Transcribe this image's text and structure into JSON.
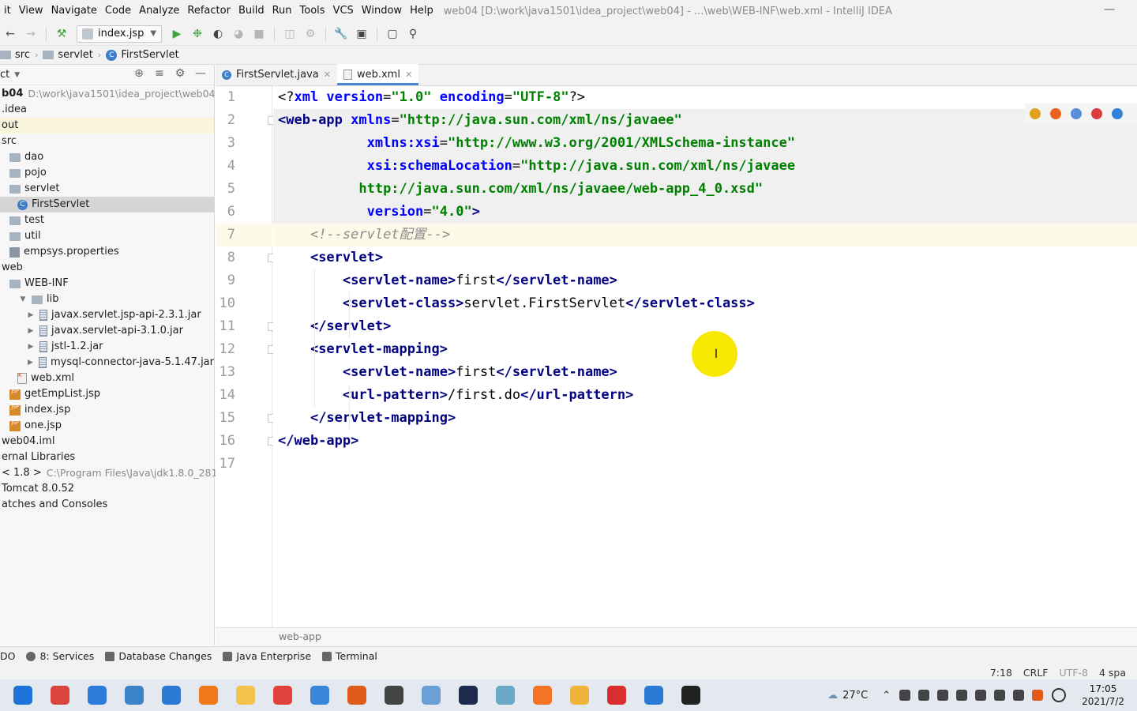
{
  "menubar": {
    "items": [
      "it",
      "View",
      "Navigate",
      "Code",
      "Analyze",
      "Refactor",
      "Build",
      "Run",
      "Tools",
      "VCS",
      "Window",
      "Help"
    ],
    "title": "web04 [D:\\work\\java1501\\idea_project\\web04] - ...\\web\\WEB-INF\\web.xml - IntelliJ IDEA",
    "minimize": "—"
  },
  "toolbar": {
    "run_config": "index.jsp",
    "icons": [
      "back-icon",
      "forward-icon",
      "build-icon",
      "run-icon",
      "debug-icon",
      "coverage-icon",
      "profile-icon",
      "stop-icon",
      "update-icon",
      "attach-icon",
      "settings-icon",
      "project-structure-icon",
      "frame-icon",
      "search-icon"
    ]
  },
  "breadcrumb": {
    "items": [
      "src",
      "servlet",
      "FirstServlet"
    ]
  },
  "project": {
    "title": "ct",
    "tree": [
      {
        "label": "b04",
        "hint": "D:\\work\\java1501\\idea_project\\web04",
        "icon": "none",
        "indent": 0,
        "bold": true
      },
      {
        "label": ".idea",
        "icon": "none",
        "indent": 0
      },
      {
        "label": "out",
        "icon": "none",
        "indent": 0,
        "marked": true
      },
      {
        "label": "src",
        "icon": "none",
        "indent": 0
      },
      {
        "label": "dao",
        "icon": "folder",
        "indent": 1
      },
      {
        "label": "pojo",
        "icon": "folder",
        "indent": 1
      },
      {
        "label": "servlet",
        "icon": "folder",
        "indent": 1
      },
      {
        "label": "FirstServlet",
        "icon": "class",
        "indent": 2,
        "selected": true
      },
      {
        "label": "test",
        "icon": "folder",
        "indent": 1
      },
      {
        "label": "util",
        "icon": "folder",
        "indent": 1
      },
      {
        "label": "empsys.properties",
        "icon": "props",
        "indent": 1
      },
      {
        "label": "web",
        "icon": "none",
        "indent": 0
      },
      {
        "label": "WEB-INF",
        "icon": "folder",
        "indent": 1
      },
      {
        "label": "lib",
        "icon": "folder",
        "indent": 2,
        "expander": "down"
      },
      {
        "label": "javax.servlet.jsp-api-2.3.1.jar",
        "icon": "jar",
        "indent": 3,
        "expander": "right"
      },
      {
        "label": "javax.servlet-api-3.1.0.jar",
        "icon": "jar",
        "indent": 3,
        "expander": "right"
      },
      {
        "label": "jstl-1.2.jar",
        "icon": "jar",
        "indent": 3,
        "expander": "right"
      },
      {
        "label": "mysql-connector-java-5.1.47.jar",
        "icon": "jar",
        "indent": 3,
        "expander": "right"
      },
      {
        "label": "web.xml",
        "icon": "xml",
        "indent": 2
      },
      {
        "label": "getEmpList.jsp",
        "icon": "jsp",
        "indent": 1
      },
      {
        "label": "index.jsp",
        "icon": "jsp",
        "indent": 1
      },
      {
        "label": "one.jsp",
        "icon": "jsp",
        "indent": 1
      },
      {
        "label": "web04.iml",
        "icon": "none",
        "indent": 0
      },
      {
        "label": "ernal Libraries",
        "icon": "none",
        "indent": 0
      },
      {
        "label": "< 1.8 >",
        "hint": "C:\\Program Files\\Java\\jdk1.8.0_281",
        "icon": "none",
        "indent": 0
      },
      {
        "label": "Tomcat 8.0.52",
        "icon": "none",
        "indent": 0
      },
      {
        "label": "atches and Consoles",
        "icon": "none",
        "indent": 0
      }
    ]
  },
  "tabs": [
    {
      "label": "FirstServlet.java",
      "icon": "class",
      "active": false
    },
    {
      "label": "web.xml",
      "icon": "xml",
      "active": true
    }
  ],
  "editor": {
    "lines": [
      {
        "n": "1",
        "tokens": [
          [
            "pi",
            "<?"
          ],
          [
            "attr",
            "xml version"
          ],
          [
            "pi",
            "="
          ],
          [
            "val",
            "\"1.0\""
          ],
          [
            "pi",
            " "
          ],
          [
            "attr",
            "encoding"
          ],
          [
            "pi",
            "="
          ],
          [
            "val",
            "\"UTF-8\""
          ],
          [
            "pi",
            "?>"
          ]
        ]
      },
      {
        "n": "2",
        "tokens": [
          [
            "tag",
            "<web-app "
          ],
          [
            "attr",
            "xmlns"
          ],
          [
            "txt",
            "="
          ],
          [
            "val",
            "\"http://java.sun.com/xml/ns/javaee\""
          ]
        ],
        "hl": true
      },
      {
        "n": "3",
        "tokens": [
          [
            "txt",
            "           "
          ],
          [
            "attr",
            "xmlns:xsi"
          ],
          [
            "txt",
            "="
          ],
          [
            "val",
            "\"http://www.w3.org/2001/XMLSchema-instance\""
          ]
        ],
        "hl": true
      },
      {
        "n": "4",
        "tokens": [
          [
            "txt",
            "           "
          ],
          [
            "attr",
            "xsi:schemaLocation"
          ],
          [
            "txt",
            "="
          ],
          [
            "val",
            "\"http://java.sun.com/xml/ns/javaee"
          ]
        ],
        "hl": true
      },
      {
        "n": "5",
        "tokens": [
          [
            "txt",
            "          "
          ],
          [
            "val",
            "http://java.sun.com/xml/ns/javaee/web-app_4_0.xsd\""
          ]
        ],
        "hl": true
      },
      {
        "n": "6",
        "tokens": [
          [
            "txt",
            "           "
          ],
          [
            "attr",
            "version"
          ],
          [
            "txt",
            "="
          ],
          [
            "val",
            "\"4.0\""
          ],
          [
            "tag",
            ">"
          ]
        ],
        "hl": true
      },
      {
        "n": "7",
        "tokens": [
          [
            "txt",
            "    "
          ],
          [
            "cmt",
            "<!--servlet配置-->"
          ]
        ],
        "cur": true
      },
      {
        "n": "8",
        "tokens": [
          [
            "txt",
            "    "
          ],
          [
            "tag",
            "<servlet>"
          ]
        ]
      },
      {
        "n": "9",
        "tokens": [
          [
            "txt",
            "        "
          ],
          [
            "tag",
            "<servlet-name>"
          ],
          [
            "txt",
            "first"
          ],
          [
            "tag",
            "</servlet-name>"
          ]
        ]
      },
      {
        "n": "10",
        "tokens": [
          [
            "txt",
            "        "
          ],
          [
            "tag",
            "<servlet-class>"
          ],
          [
            "txt",
            "servlet.FirstServlet"
          ],
          [
            "tag",
            "</servlet-class>"
          ]
        ]
      },
      {
        "n": "11",
        "tokens": [
          [
            "txt",
            "    "
          ],
          [
            "tag",
            "</servlet>"
          ]
        ]
      },
      {
        "n": "12",
        "tokens": [
          [
            "txt",
            "    "
          ],
          [
            "tag",
            "<servlet-mapping>"
          ]
        ]
      },
      {
        "n": "13",
        "tokens": [
          [
            "txt",
            "        "
          ],
          [
            "tag",
            "<servlet-name>"
          ],
          [
            "txt",
            "first"
          ],
          [
            "tag",
            "</servlet-name>"
          ]
        ]
      },
      {
        "n": "14",
        "tokens": [
          [
            "txt",
            "        "
          ],
          [
            "tag",
            "<url-pattern>"
          ],
          [
            "txt",
            "/first.do"
          ],
          [
            "tag",
            "</url-pattern>"
          ]
        ]
      },
      {
        "n": "15",
        "tokens": [
          [
            "txt",
            "    "
          ],
          [
            "tag",
            "</servlet-mapping>"
          ]
        ]
      },
      {
        "n": "16",
        "tokens": [
          [
            "tag",
            "</web-app>"
          ]
        ]
      },
      {
        "n": "17",
        "tokens": []
      }
    ],
    "breadcrumb": "web-app",
    "browser_colors": [
      "#e0a11b",
      "#e8631f",
      "#5b8fd9",
      "#d93e3e",
      "#2f83d6"
    ]
  },
  "toolwindows": [
    {
      "label": "DO",
      "icon": "none"
    },
    {
      "label": "8: Services",
      "icon": "round"
    },
    {
      "label": "Database Changes",
      "icon": "square"
    },
    {
      "label": "Java Enterprise",
      "icon": "square"
    },
    {
      "label": "Terminal",
      "icon": "square"
    }
  ],
  "statusbar": {
    "position": "7:18",
    "line_sep": "CRLF",
    "encoding": "UTF-8",
    "indent": "4 spa"
  },
  "taskbar": {
    "app_colors": [
      "#1e73d8",
      "#d9443f",
      "#2e7ad9",
      "#3b82c9",
      "#2d7ad6",
      "#f07a1a",
      "#f3c44a",
      "#e0413a",
      "#3a86d8",
      "#e05a1a",
      "#444",
      "#6aa0d6",
      "#1c2a4d",
      "#6aa8c8",
      "#f37425",
      "#f0b43a",
      "#d92e2e",
      "#2a7bd6",
      "#222"
    ],
    "weather": "27°C",
    "time": "17:05",
    "date": "2021/7/2"
  }
}
